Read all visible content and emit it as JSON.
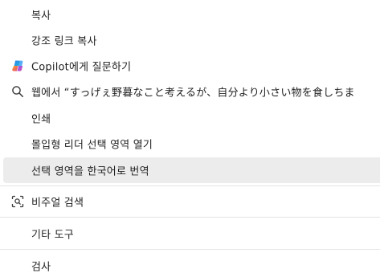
{
  "menu": {
    "items": [
      {
        "label": "복사"
      },
      {
        "label": "강조 링크 복사"
      },
      {
        "label": "Copilot에게 질문하기",
        "icon": "copilot-icon"
      },
      {
        "label": "웹에서 “すっげぇ野暮なこと考えるが、自分より小さい物を食しちま",
        "icon": "search-icon"
      },
      {
        "label": "인쇄"
      },
      {
        "label": "몰입형 리더 선택 영역 열기"
      },
      {
        "label": "선택 영역을 한국어로 번역"
      },
      {
        "label": "비주얼 검색",
        "icon": "visual-search-icon"
      },
      {
        "label": "기타 도구"
      },
      {
        "label": "검사"
      }
    ],
    "highlight_color": "#ececec",
    "divider_color": "#e3e3e3"
  }
}
